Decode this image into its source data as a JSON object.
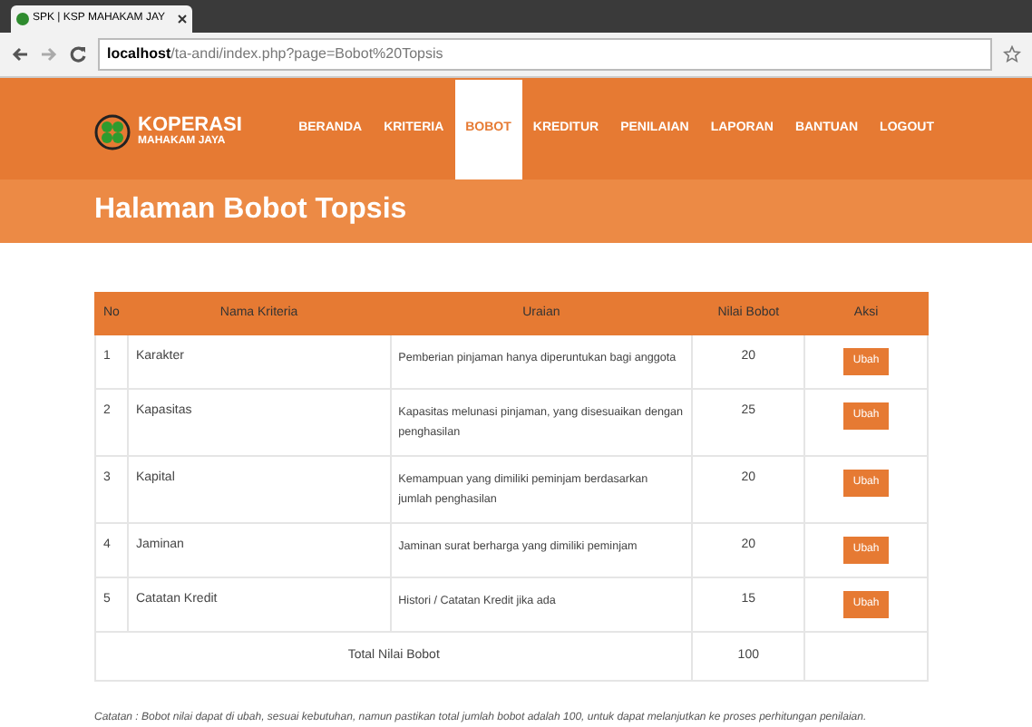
{
  "browser": {
    "tab_title": "SPK | KSP MAHAKAM JAY",
    "url_host": "localhost",
    "url_path": "/ta-andi/index.php?page=Bobot%20Topsis"
  },
  "brand": {
    "name": "KOPERASI",
    "subtitle": "MAHAKAM JAYA"
  },
  "nav": [
    {
      "label": "BERANDA",
      "selected": false
    },
    {
      "label": "KRITERIA",
      "selected": false
    },
    {
      "label": "BOBOT",
      "selected": true
    },
    {
      "label": "KREDITUR",
      "selected": false
    },
    {
      "label": "PENILAIAN",
      "selected": false
    },
    {
      "label": "LAPORAN",
      "selected": false
    },
    {
      "label": "BANTUAN",
      "selected": false
    },
    {
      "label": "LOGOUT",
      "selected": false
    }
  ],
  "page_title": "Halaman Bobot Topsis",
  "table": {
    "columns": [
      "No",
      "Nama Kriteria",
      "Uraian",
      "Nilai Bobot",
      "Aksi"
    ],
    "rows": [
      {
        "no": "1",
        "name": "Karakter",
        "description": "Pemberian pinjaman hanya diperuntukan bagi anggota",
        "weight": "20",
        "action": "Ubah"
      },
      {
        "no": "2",
        "name": "Kapasitas",
        "description": "Kapasitas melunasi pinjaman, yang disesuaikan dengan penghasilan",
        "weight": "25",
        "action": "Ubah"
      },
      {
        "no": "3",
        "name": "Kapital",
        "description": "Kemampuan yang dimiliki peminjam berdasarkan jumlah penghasilan",
        "weight": "20",
        "action": "Ubah"
      },
      {
        "no": "4",
        "name": "Jaminan",
        "description": "Jaminan surat berharga yang dimiliki peminjam",
        "weight": "20",
        "action": "Ubah"
      },
      {
        "no": "5",
        "name": "Catatan Kredit",
        "description": "Histori / Catatan Kredit jika ada",
        "weight": "15",
        "action": "Ubah"
      }
    ],
    "total_label": "Total Nilai Bobot",
    "total_value": "100"
  },
  "note": "Catatan : Bobot nilai dapat di ubah, sesuai kebutuhan, namun pastikan total jumlah bobot adalah 100, untuk dapat melanjutkan ke proses perhitungan penilaian."
}
